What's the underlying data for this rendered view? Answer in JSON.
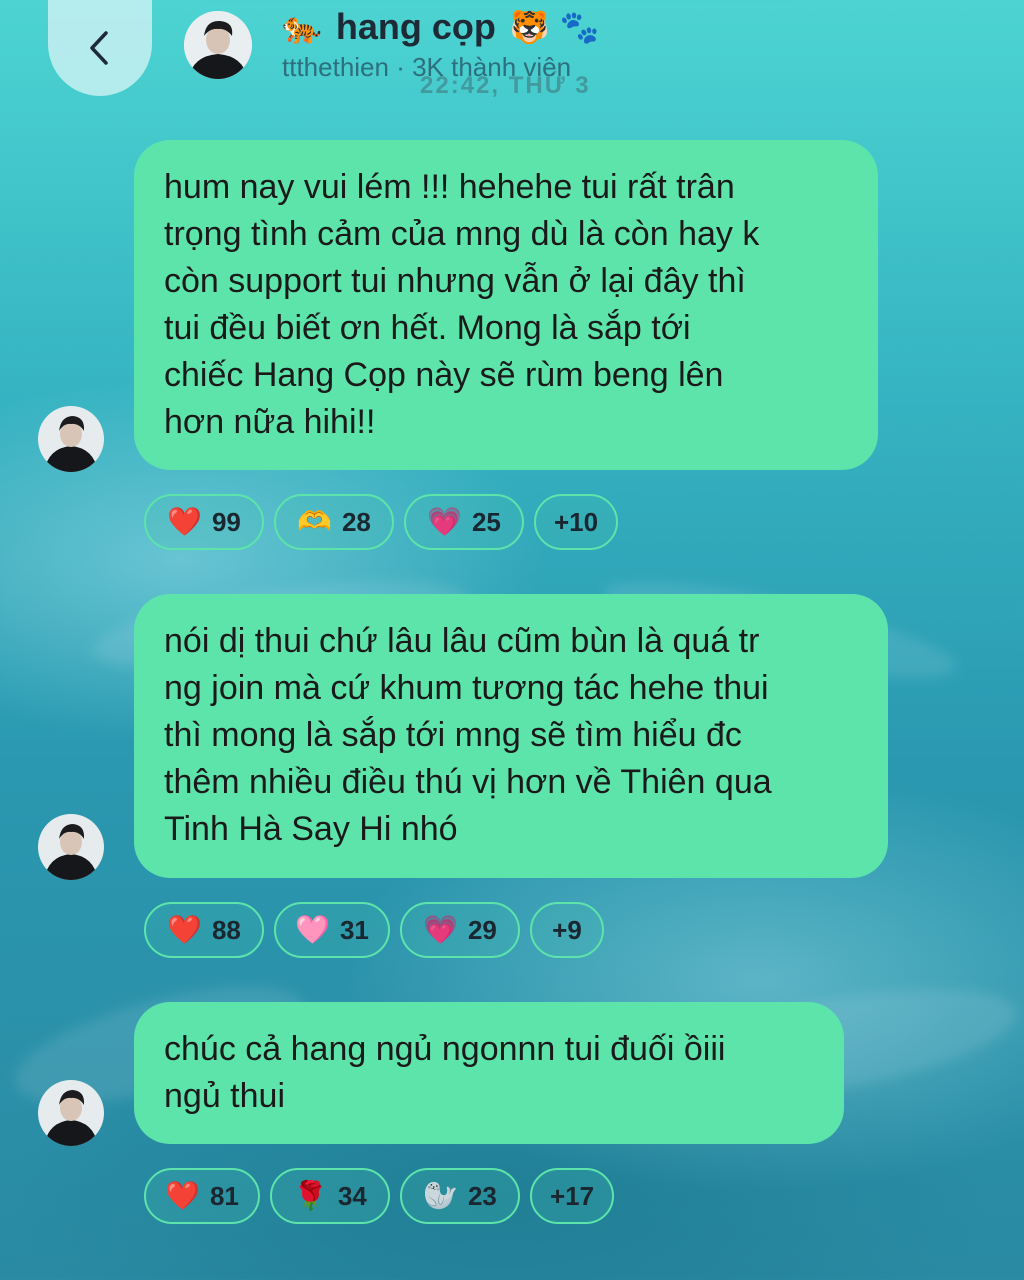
{
  "header": {
    "back_label": "back",
    "title_emoji_left": "🐅",
    "title": "hang cọp",
    "title_emoji_right": "🐯",
    "title_emoji_paw": "🐾",
    "subtitle": "ttthethien · 3K thành viên",
    "timestamp": "22:42, THỨ 3"
  },
  "messages": [
    {
      "lines": [
        "hum nay vui lém !!! hehehe tui rất trân",
        "trọng tình cảm của mng dù là còn hay k",
        "còn support tui nhưng vẫn ở lại đây thì",
        "tui đều biết ơn hết. Mong là sắp tới",
        "chiếc Hang Cọp này sẽ rùm beng lên",
        "hơn nữa hihi!!"
      ],
      "reactions": [
        {
          "emoji": "❤️",
          "count": "99"
        },
        {
          "emoji": "🫶",
          "count": "28"
        },
        {
          "emoji": "💗",
          "count": "25"
        },
        {
          "emoji": "",
          "count": "+10"
        }
      ]
    },
    {
      "lines": [
        "nói dị thui chứ lâu lâu cũm bùn là quá tr",
        "ng join mà cứ khum tương tác hehe thui",
        "thì mong là sắp tới mng sẽ tìm hiểu đc",
        "thêm nhiều điều thú vị hơn về Thiên qua",
        "Tinh Hà Say Hi nhó"
      ],
      "reactions": [
        {
          "emoji": "❤️",
          "count": "88"
        },
        {
          "emoji": "🩷",
          "count": "31"
        },
        {
          "emoji": "💗",
          "count": "29"
        },
        {
          "emoji": "",
          "count": "+9"
        }
      ]
    },
    {
      "lines": [
        "chúc cả hang ngủ ngonnn tui đuối ồiii",
        "ngủ thui"
      ],
      "reactions": [
        {
          "emoji": "❤️",
          "count": "81"
        },
        {
          "emoji": "🌹",
          "count": "34"
        },
        {
          "emoji": "🦭",
          "count": "23"
        },
        {
          "emoji": "",
          "count": "+17"
        }
      ]
    }
  ]
}
